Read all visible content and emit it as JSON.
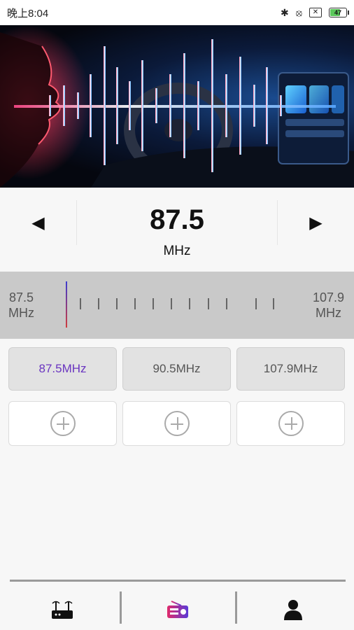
{
  "status_bar": {
    "time": "晚上8:04",
    "battery_level": "47"
  },
  "tuner": {
    "frequency": "87.5",
    "unit": "MHz",
    "min_value": "87.5",
    "min_unit": "MHz",
    "max_value": "107.9",
    "max_unit": "MHz"
  },
  "presets": [
    {
      "label": "87.5MHz",
      "active": true
    },
    {
      "label": "90.5MHz",
      "active": false
    },
    {
      "label": "107.9MHz",
      "active": false
    }
  ],
  "colors": {
    "accent": "#6a35c0",
    "needle_top": "#3c3cd0",
    "needle_bottom": "#d03c3c",
    "tuner_bg": "#c9c9c9"
  },
  "icons": {
    "prev": "triangle-left-icon",
    "next": "triangle-right-icon",
    "nav_router": "router-icon",
    "nav_radio": "radio-icon",
    "nav_profile": "user-icon"
  }
}
